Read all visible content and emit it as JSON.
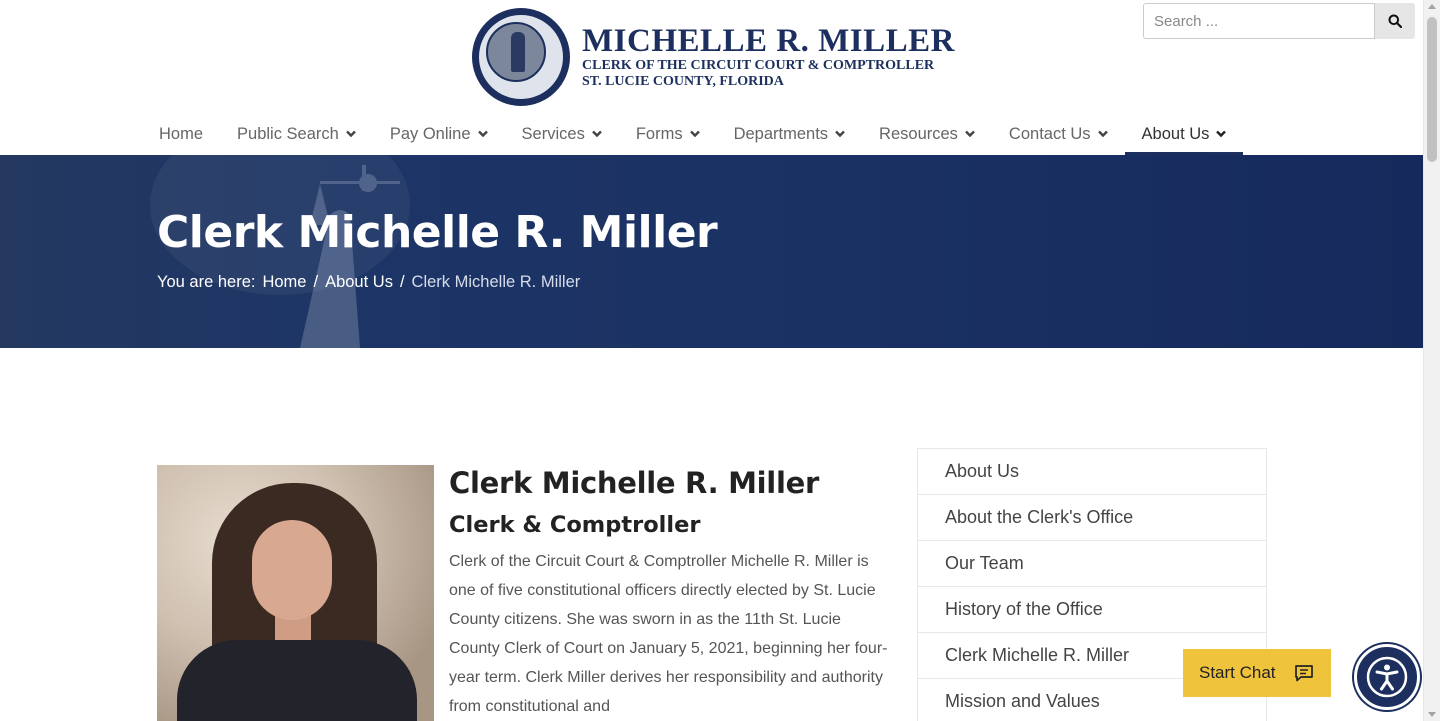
{
  "header": {
    "logo": {
      "name": "MICHELLE R. MILLER",
      "line2": "CLERK OF THE CIRCUIT COURT & COMPTROLLER",
      "line3": "ST. LUCIE COUNTY, FLORIDA"
    },
    "search": {
      "placeholder": "Search ..."
    }
  },
  "nav": {
    "items": [
      {
        "label": "Home",
        "dropdown": false
      },
      {
        "label": "Public Search",
        "dropdown": true
      },
      {
        "label": "Pay Online",
        "dropdown": true
      },
      {
        "label": "Services",
        "dropdown": true
      },
      {
        "label": "Forms",
        "dropdown": true
      },
      {
        "label": "Departments",
        "dropdown": true
      },
      {
        "label": "Resources",
        "dropdown": true
      },
      {
        "label": "Contact Us",
        "dropdown": true
      },
      {
        "label": "About Us",
        "dropdown": true,
        "active": true
      }
    ]
  },
  "hero": {
    "title": "Clerk Michelle R. Miller",
    "breadcrumb": {
      "prefix": "You are here:",
      "items": [
        "Home",
        "About Us"
      ],
      "separator": "/",
      "current": "Clerk Michelle R. Miller"
    }
  },
  "bio": {
    "name": "Clerk Michelle R. Miller",
    "role": "Clerk & Comptroller",
    "text": "Clerk of the Circuit Court & Comptroller Michelle R. Miller is one of five constitutional officers directly elected by St. Lucie County citizens. She was sworn in as the 11th St. Lucie County Clerk of Court on January 5, 2021, beginning her four-year term. Clerk Miller derives her responsibility and authority from constitutional and"
  },
  "sidebar": {
    "items": [
      "About Us",
      "About the Clerk's Office",
      "Our Team",
      "History of the Office",
      "Clerk Michelle R. Miller",
      "Mission and Values"
    ]
  },
  "chat": {
    "label": "Start Chat"
  },
  "colors": {
    "brand": "#1c2f5e",
    "chat": "#f0c33c",
    "hero": "#1a3163"
  },
  "icons": [
    "search-icon",
    "chevron-down-icon",
    "chat-icon",
    "accessibility-icon"
  ]
}
